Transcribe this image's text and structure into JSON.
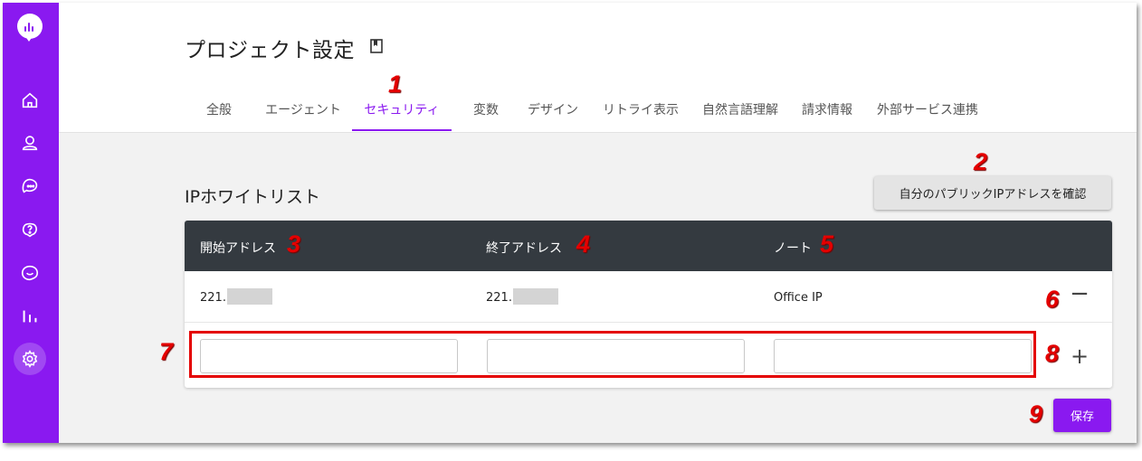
{
  "app": {
    "page_title": "プロジェクト設定",
    "tabs": [
      "全般",
      "エージェント",
      "セキュリティ",
      "変数",
      "デザイン",
      "リトライ表示",
      "自然言語理解",
      "請求情報",
      "外部サービス連携"
    ],
    "active_tab": "セキュリティ"
  },
  "sidebar": {
    "icons": [
      "home-icon",
      "user-icon",
      "chat-icon",
      "help-icon",
      "feedback-icon",
      "analytics-icon",
      "settings-icon"
    ],
    "active": "settings-icon"
  },
  "security": {
    "section_title": "IPホワイトリスト",
    "check_ip_label": "自分のパブリックIPアドレスを確認",
    "table": {
      "headers": [
        "開始アドレス",
        "終了アドレス",
        "ノート"
      ],
      "rows": [
        {
          "start": "221.",
          "end": "221.",
          "note": "Office IP"
        }
      ],
      "new_row": {
        "start": "",
        "end": "",
        "note": ""
      }
    },
    "remove_symbol": "−",
    "add_symbol": "+",
    "save_label": "保存"
  },
  "annotations": [
    "1",
    "2",
    "3",
    "4",
    "5",
    "6",
    "7",
    "8",
    "9"
  ],
  "colors": {
    "accent": "#8a19f0",
    "header_dark": "#343a40",
    "callout": "#e40000"
  }
}
